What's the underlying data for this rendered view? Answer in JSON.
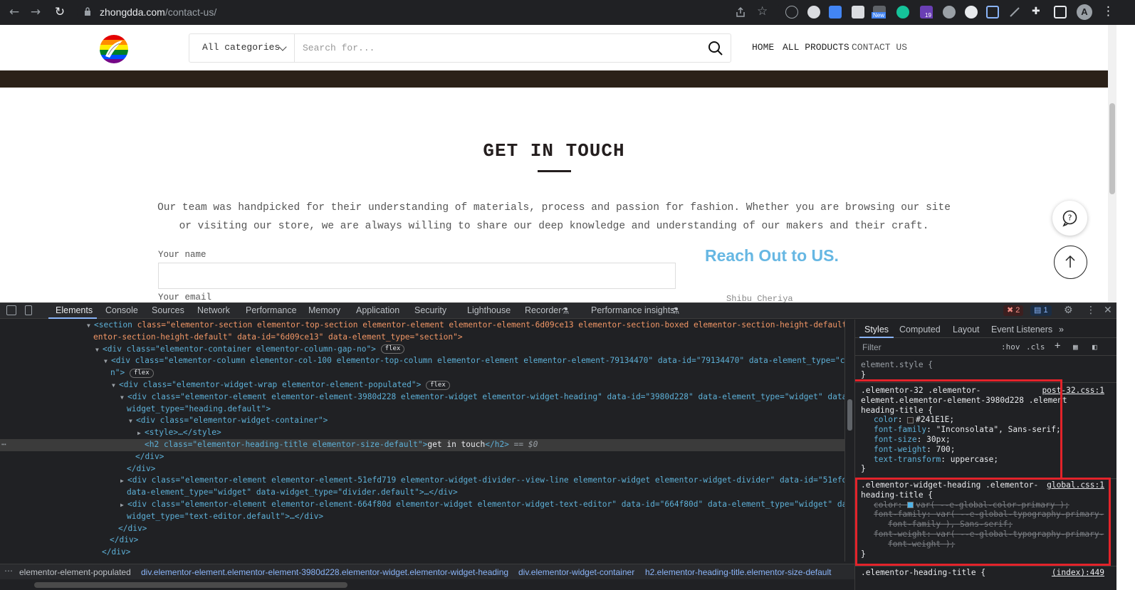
{
  "browser": {
    "url_host": "zhongdda.com",
    "url_path": "/contact-us/",
    "profile_initial": "A",
    "extension_badges": {
      "new": "New",
      "count": "19"
    }
  },
  "site": {
    "category_select": "All categories",
    "search_placeholder": "Search for...",
    "nav": [
      "HOME",
      "ALL PRODUCTS",
      "CONTACT US"
    ],
    "heading": "get in touch",
    "intro": "Our team was handpicked for their understanding of materials, process and passion for fashion. Whether you are browsing our site or visiting our store, we are always willing to share our deep knowledge and understanding of our makers and their craft.",
    "name_label": "Your name",
    "email_label": "Your email",
    "reach_out": "Reach Out to US.",
    "ghost_text": "Shibu Cheriya",
    "heading_color": "#241E1E",
    "reach_color": "#66b7e3"
  },
  "devtools": {
    "tabs": [
      "Elements",
      "Console",
      "Sources",
      "Network",
      "Performance",
      "Memory",
      "Application",
      "Security",
      "Lighthouse",
      "Recorder",
      "Performance insights"
    ],
    "errors": "2",
    "messages": "1",
    "dom": {
      "l1_tag_open": "<section",
      "l1_attrs": " class=\"elementor-section elementor-top-section elementor-element elementor-element-6d09ce13 elementor-section-boxed elementor-section-height-default elem",
      "l1b": "entor-section-height-default\" data-id=\"6d09ce13\" data-element_type=\"section\">",
      "l2": "<div class=\"elementor-container elementor-column-gap-no\">",
      "l3": "<div class=\"elementor-column elementor-col-100 elementor-top-column elementor-element elementor-element-79134470\" data-id=\"79134470\" data-element_type=\"colum",
      "l3b": "n\">",
      "l4": "<div class=\"elementor-widget-wrap elementor-element-populated\">",
      "l5": "<div class=\"elementor-element elementor-element-3980d228 elementor-widget elementor-widget-heading\" data-id=\"3980d228\" data-element_type=\"widget\" data-",
      "l5b": "widget_type=\"heading.default\">",
      "l6": "<div class=\"elementor-widget-container\">",
      "l7": "<style>…</style>",
      "l8_open": "<h2 class=\"elementor-heading-title elementor-size-default\">",
      "l8_text": "get in touch",
      "l8_close": "</h2>",
      "l8_eq": " == $0",
      "l9": "</div>",
      "l10": "</div>",
      "l11": "<div class=\"elementor-element elementor-element-51efd719 elementor-widget-divider--view-line elementor-widget elementor-widget-divider\" data-id=\"51efd719\"",
      "l11b": "data-element_type=\"widget\" data-widget_type=\"divider.default\">…</div>",
      "l12": "<div class=\"elementor-element elementor-element-664f80d elementor-widget elementor-widget-text-editor\" data-id=\"664f80d\" data-element_type=\"widget\" data-",
      "l12b": "widget_type=\"text-editor.default\">…</div>",
      "l13": "</div>",
      "l14": "</div>",
      "l15": "</div>",
      "flex": "flex"
    },
    "breadcrumbs": [
      "elementor-element-populated",
      "div.elementor-element.elementor-element-3980d228.elementor-widget.elementor-widget-heading",
      "div.elementor-widget-container",
      "h2.elementor-heading-title.elementor-size-default"
    ],
    "styles_tabs": [
      "Styles",
      "Computed",
      "Layout",
      "Event Listeners"
    ],
    "filter_placeholder": "Filter",
    "hov": ":hov",
    "cls": ".cls",
    "element_style": "element.style {",
    "rule1": {
      "sel1": ".elementor-32 .elementor-",
      "sel2": "element.elementor-element-3980d228 .element",
      "sel3": "heading-title {",
      "src": "post-32.css:1",
      "props": [
        {
          "name": "color",
          "value": "#241E1E;"
        },
        {
          "name": "font-family",
          "value": "\"Inconsolata\", Sans-serif;"
        },
        {
          "name": "font-size",
          "value": "30px;"
        },
        {
          "name": "font-weight",
          "value": "700;"
        },
        {
          "name": "text-transform",
          "value": "uppercase;"
        }
      ]
    },
    "rule2": {
      "sel1": ".elementor-widget-heading .elementor-",
      "sel2": "heading-title {",
      "src": "global.css:1",
      "p1": "color: ",
      "p1v": "var( --e-global-color-primary );",
      "p2": "font-family: var( --e-global-typography-primary-",
      "p2b": "font-family ), Sans-serif;",
      "p3": "font-weight: var( --e-global-typography-primary-",
      "p3b": "font-weight );"
    },
    "rule3": {
      "sel": ".elementor-heading-title {",
      "src": "(index):449"
    },
    "close_brace": "}"
  }
}
